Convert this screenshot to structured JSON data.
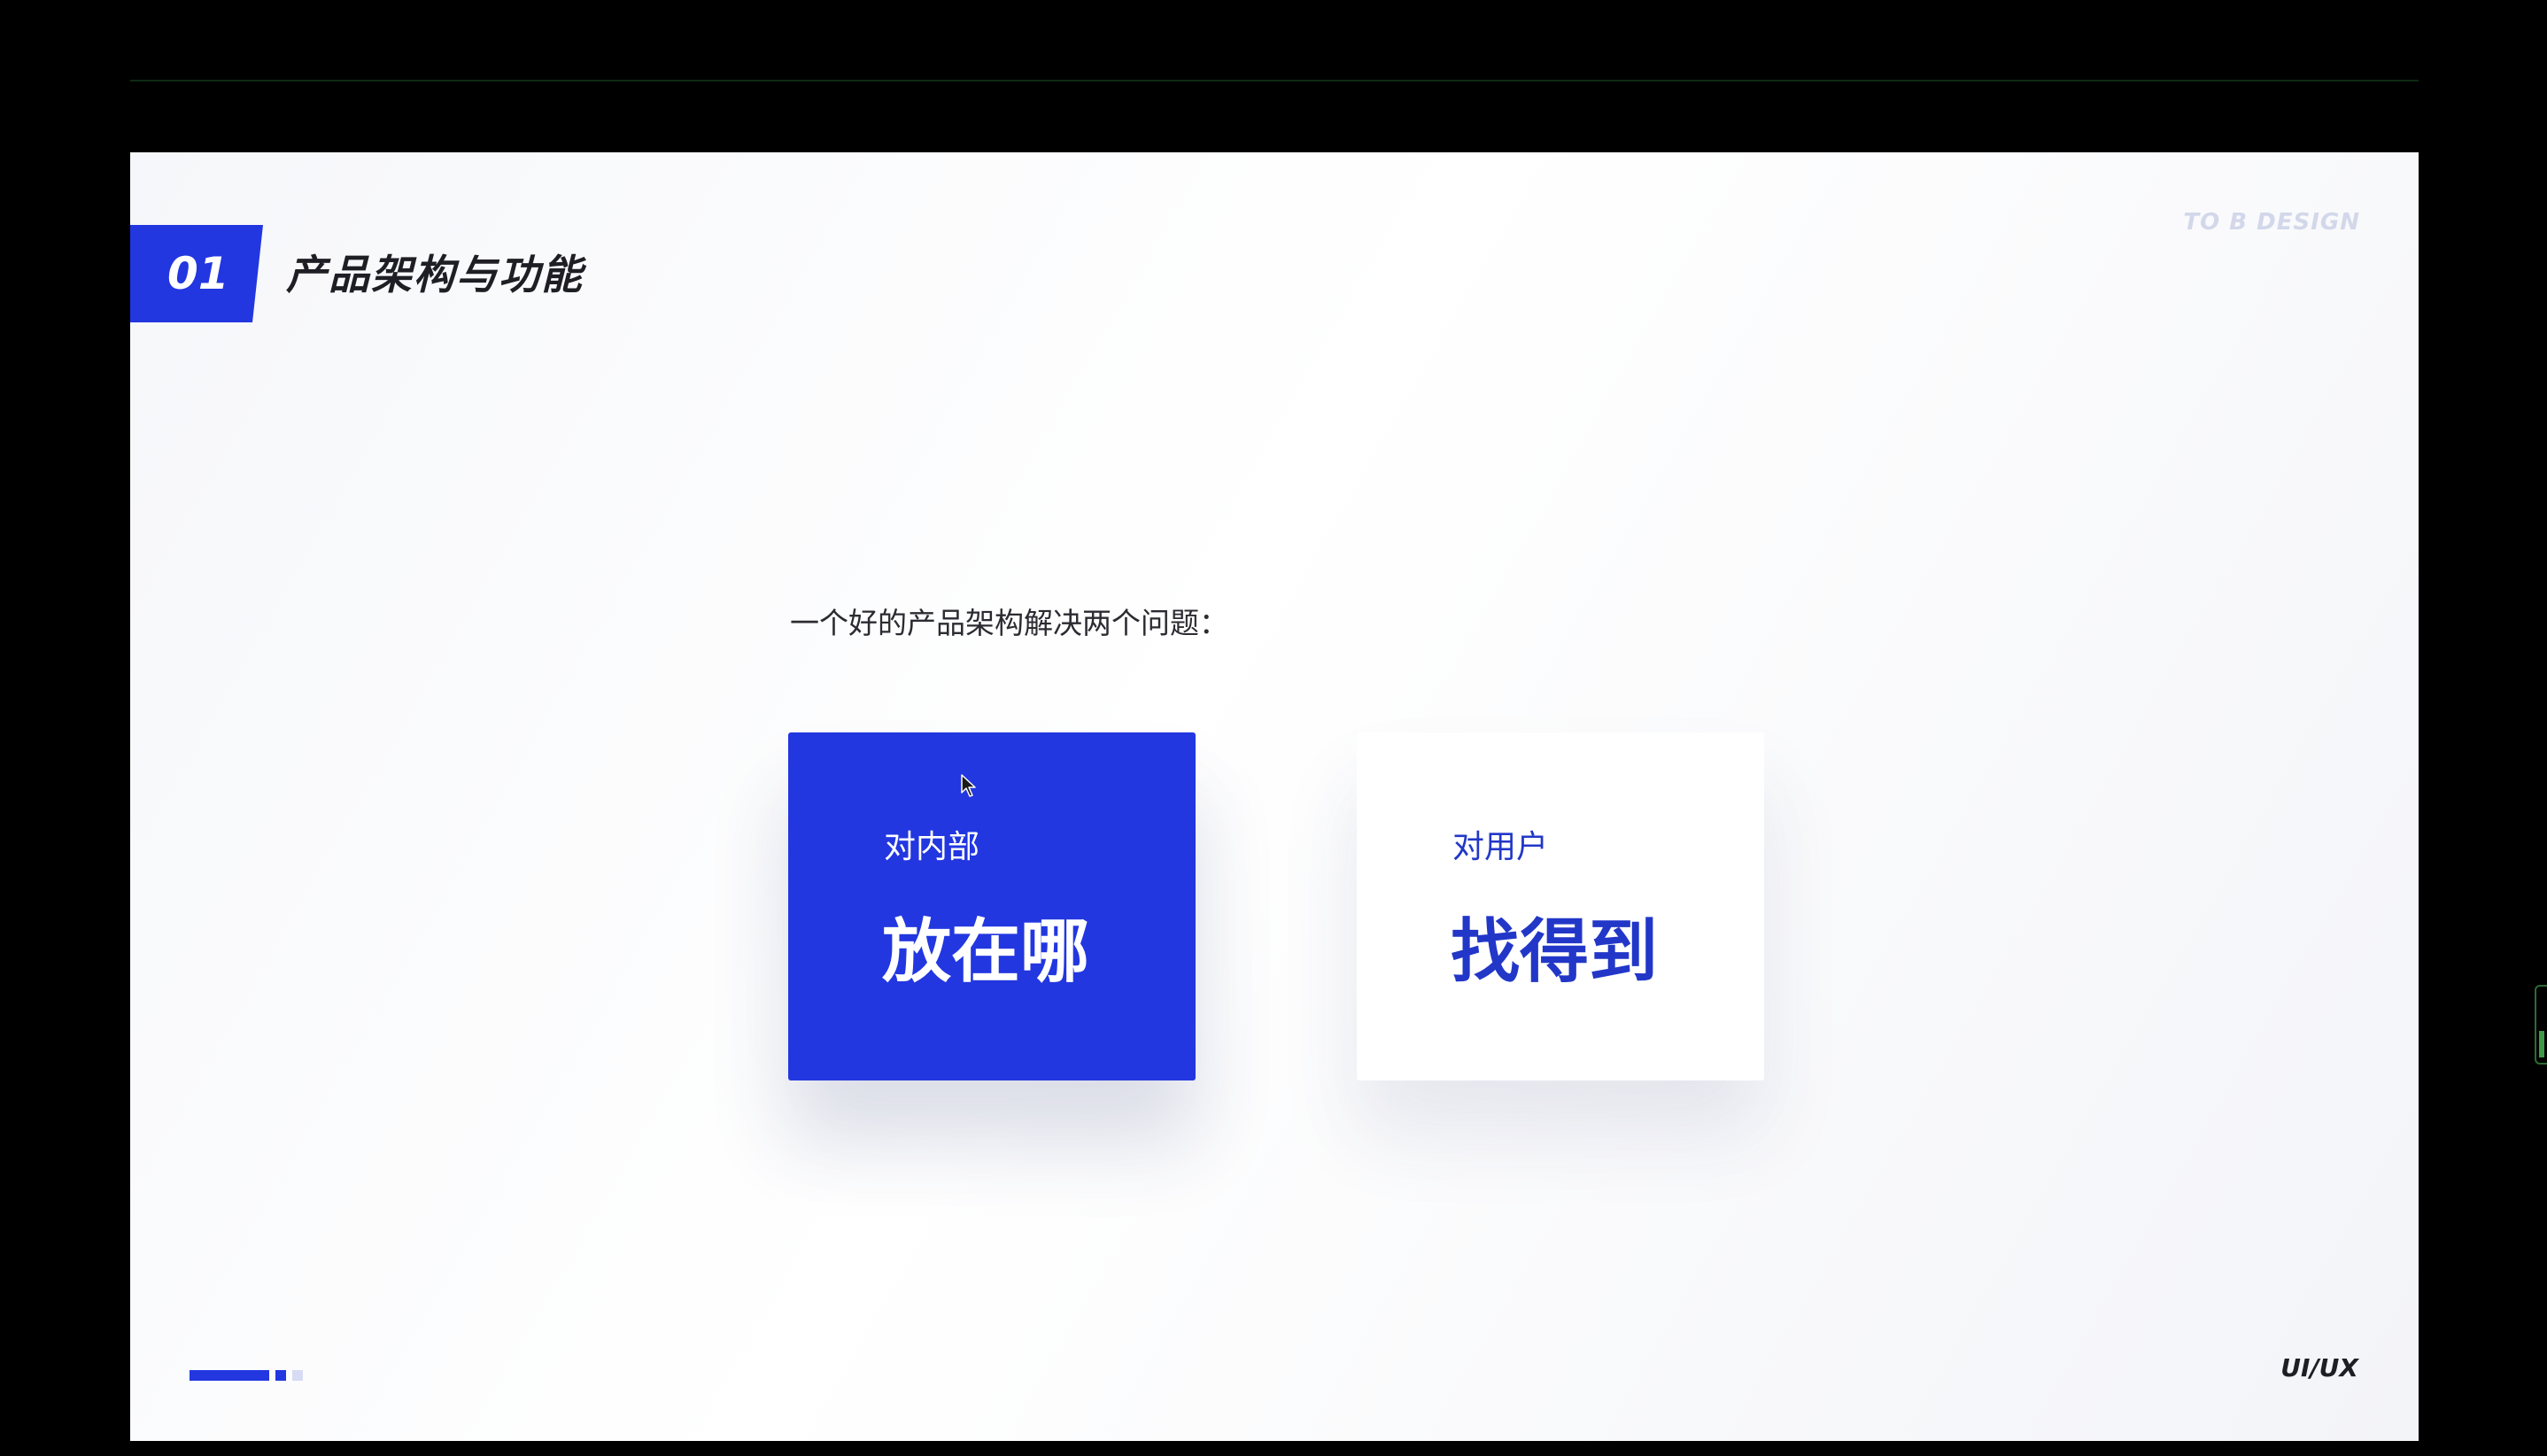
{
  "slide": {
    "section_number": "01",
    "section_title": "产品架构与功能",
    "watermark": "TO B DESIGN",
    "intro_text": "一个好的产品架构解决两个问题：",
    "cards": [
      {
        "label": "对内部",
        "headline": "放在哪"
      },
      {
        "label": "对用户",
        "headline": "找得到"
      }
    ],
    "pager": {
      "current_page": 1,
      "total_pages": 3
    },
    "footer_tag": "UI/UX"
  },
  "colors": {
    "accent": "#2237e0",
    "page_background": "#000000",
    "slide_background": "#f7f8fb",
    "card_secondary_text": "#2237c8"
  },
  "icons": {
    "cursor": "mouse-pointer-icon"
  }
}
